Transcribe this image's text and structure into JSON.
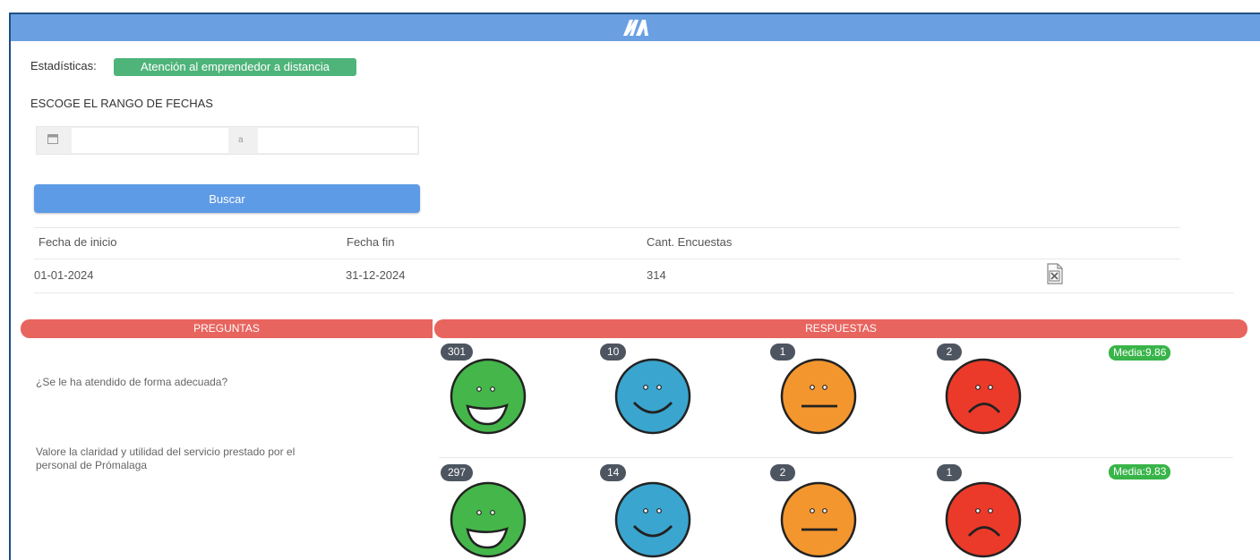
{
  "header": {
    "logo_icon": "promalaga-logo"
  },
  "stats": {
    "label": "Estadísticas:",
    "selected": "Atención al emprendedor a distancia"
  },
  "date_range": {
    "title": "ESCOGE EL RANGO DE FECHAS",
    "from_value": "",
    "separator": "a",
    "to_value": ""
  },
  "search_button": "Buscar",
  "summary_table": {
    "headers": [
      "Fecha de inicio",
      "Fecha fin",
      "Cant. Encuestas"
    ],
    "row": {
      "start": "01-01-2024",
      "end": "31-12-2024",
      "count": "314",
      "export_icon": "excel-export-icon"
    }
  },
  "survey": {
    "questions_header": "PREGUNTAS",
    "answers_header": "RESPUESTAS",
    "face_colors": {
      "very_happy": "#45b74a",
      "happy": "#3aa5cf",
      "neutral": "#f4962e",
      "sad": "#ec3a2a"
    },
    "rows": [
      {
        "question": "¿Se le ha atendido de forma adecuada?",
        "counts": [
          "301",
          "10",
          "1",
          "2"
        ],
        "media": "Media:9.86"
      },
      {
        "question": "Valore la claridad y utilidad del servicio prestado por el personal de Prómalaga",
        "counts": [
          "297",
          "14",
          "2",
          "1"
        ],
        "media": "Media:9.83"
      }
    ]
  }
}
